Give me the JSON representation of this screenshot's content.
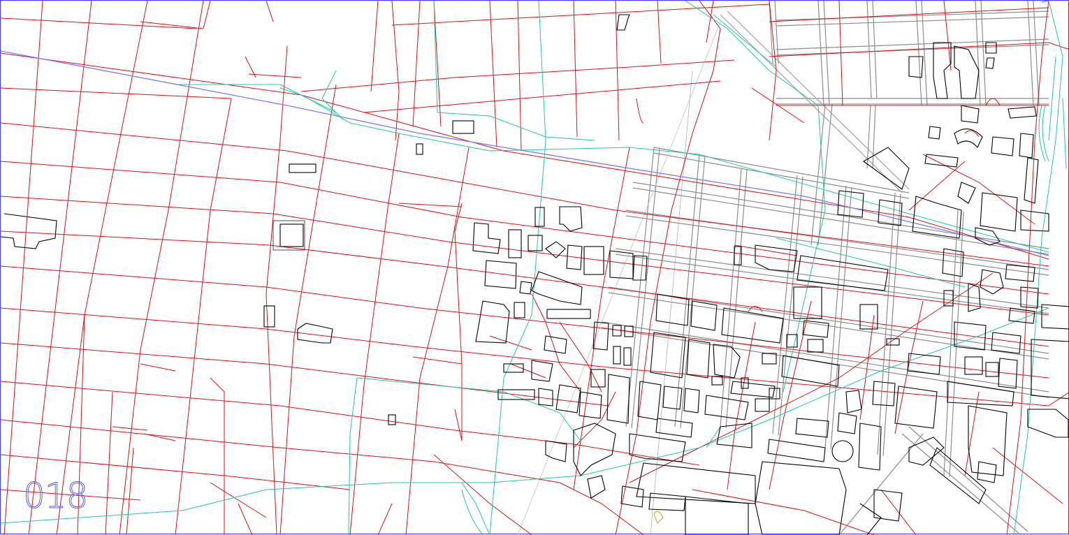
{
  "map": {
    "sheet_number": "018",
    "colors": {
      "frame": "#3a3aff",
      "street_centerline": "#e01010",
      "curb": "#8c8c8c",
      "building": "#000000",
      "transit": "#1fc8a8",
      "rail": "#7a7aff",
      "label": "#5a5aff"
    }
  }
}
